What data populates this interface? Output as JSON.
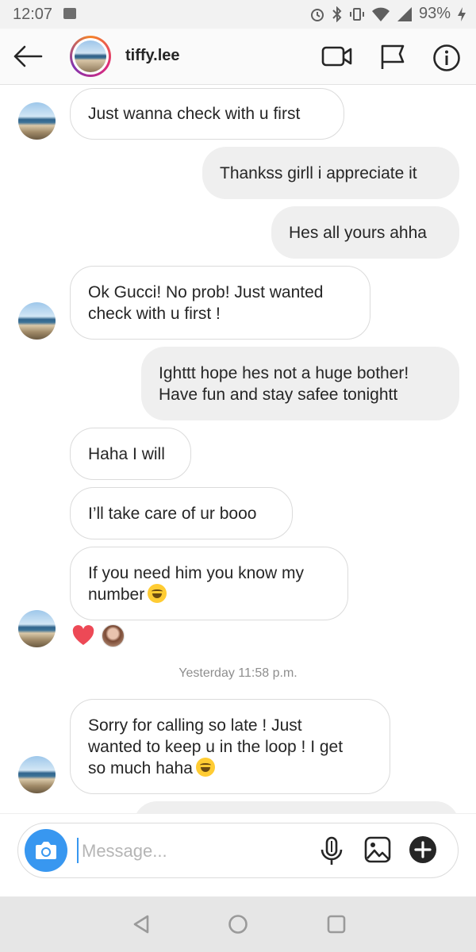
{
  "status_bar": {
    "time": "12:07",
    "battery": "93%",
    "icons": [
      "image-icon",
      "alarm-icon",
      "bluetooth-icon",
      "vibrate-icon",
      "wifi-icon",
      "signal-icon",
      "battery-charging-icon"
    ]
  },
  "header": {
    "username": "tiffy.lee",
    "icons": [
      "back-arrow-icon",
      "video-call-icon",
      "flag-icon",
      "info-icon"
    ]
  },
  "messages": [
    {
      "side": "in",
      "text": "Just wanna check with u first"
    },
    {
      "side": "out",
      "text": "Thankss girll i appreciate it"
    },
    {
      "side": "out",
      "text": "Hes all yours ahha"
    },
    {
      "side": "in",
      "text": "Ok Gucci! No prob! Just wanted\ncheck with u first !"
    },
    {
      "side": "out",
      "text": "Ighttt hope hes not a huge bother!\nHave fun and stay safee tonightt"
    },
    {
      "side": "in",
      "text": "Haha I will"
    },
    {
      "side": "in",
      "text": "I’ll take care of ur booo"
    },
    {
      "side": "in",
      "text": "If you need him you know my\nnumber",
      "emoji": "laughing-tears-emoji"
    },
    {
      "side": "in",
      "text": "Sorry for calling so late ! Just\nwanted to keep u in the loop ! I get\nso much haha",
      "emoji": "laughing-tears-emoji"
    }
  ],
  "reaction": {
    "icon": "heart-icon",
    "color": "#ed4956"
  },
  "timestamp": "Yesterday 11:58 p.m.",
  "composer": {
    "placeholder": "Message...",
    "icons": [
      "camera-icon",
      "microphone-icon",
      "gallery-icon",
      "plus-icon"
    ],
    "camera_color": "#3897f0"
  },
  "nav_bar": {
    "icons": [
      "back-triangle-icon",
      "home-circle-icon",
      "recents-square-icon"
    ]
  }
}
